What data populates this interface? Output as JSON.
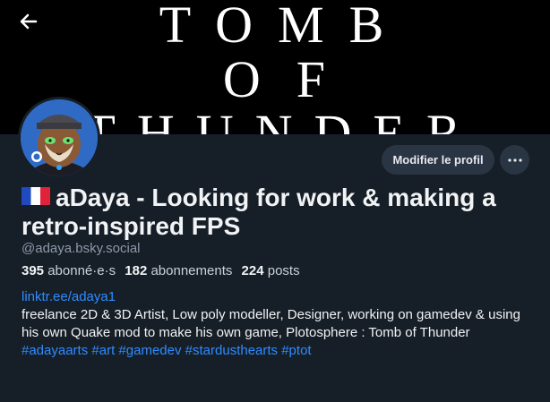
{
  "banner": {
    "lines": [
      "TOMB",
      "OF",
      "THUNDER"
    ]
  },
  "header": {
    "back_icon": "arrow-left-icon"
  },
  "profile": {
    "flag_icon": "french-flag-icon",
    "display_name": "aDaya - Looking for work & making a retro-inspired FPS",
    "handle": "@adaya.bsky.social",
    "edit_label": "Modifier le profil",
    "more_label": "···",
    "stats": {
      "followers_count": "395",
      "followers_label": "abonné·e·s",
      "following_count": "182",
      "following_label": "abonnements",
      "posts_count": "224",
      "posts_label": "posts"
    },
    "bio_link": "linktr.ee/adaya1",
    "bio_text": "freelance 2D & 3D Artist, Low poly modeller, Designer, working on gamedev & using his own Quake mod to make his own game, Plotosphere : Tomb of Thunder",
    "hashtags": [
      "#adayaarts",
      "#art",
      "#gamedev",
      "#stardusthearts",
      "#ptot"
    ]
  },
  "colors": {
    "background": "#161e27",
    "accent_link": "#2f8cff",
    "button_bg": "#2a3543",
    "muted_text": "#8c9aab"
  }
}
